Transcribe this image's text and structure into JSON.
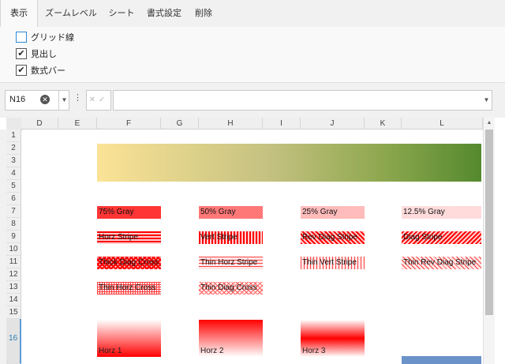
{
  "ribbon": {
    "tabs": [
      {
        "label": "表示",
        "active": true
      },
      {
        "label": "ズームレベル",
        "active": false
      },
      {
        "label": "シート",
        "active": false
      },
      {
        "label": "書式設定",
        "active": false
      },
      {
        "label": "削除",
        "active": false
      }
    ],
    "options": [
      {
        "label": "グリッド線",
        "checked": false
      },
      {
        "label": "見出し",
        "checked": true
      },
      {
        "label": "数式バー",
        "checked": true
      }
    ]
  },
  "formula_bar": {
    "name_box": "N16",
    "formula": ""
  },
  "sheet": {
    "columns": [
      "D",
      "E",
      "F",
      "G",
      "H",
      "I",
      "J",
      "K",
      "L"
    ],
    "rows": [
      "1",
      "2",
      "3",
      "4",
      "5",
      "6",
      "7",
      "8",
      "9",
      "10",
      "11",
      "12",
      "13",
      "14",
      "15",
      "16"
    ],
    "selected_row": "16",
    "gradient_colors": [
      "#fbe396",
      "#55892f"
    ],
    "pattern_cells": [
      {
        "label": "75% Gray",
        "style": "gray75"
      },
      {
        "label": "50% Gray",
        "style": "gray50"
      },
      {
        "label": "25% Gray",
        "style": "gray25"
      },
      {
        "label": "12.5% Gray",
        "style": "gray125"
      },
      {
        "label": "Horz Stripe",
        "style": "horz"
      },
      {
        "label": "Vert Stripe",
        "style": "vert"
      },
      {
        "label": "Rev Diag Stripe",
        "style": "revdiag"
      },
      {
        "label": "Diag Stripe",
        "style": "diag"
      },
      {
        "label": "Thick Diag Cross",
        "style": "thickcross"
      },
      {
        "label": "Thin Horz Stripe",
        "style": "thinhorz"
      },
      {
        "label": "Thin Vert Stripe",
        "style": "thinvert"
      },
      {
        "label": "Thin Rev Diag Stripe",
        "style": "thinrevdiag"
      },
      {
        "label": "Thin Horz Cross",
        "style": "thinhorzcross"
      },
      {
        "label": "Thin Diag Cross",
        "style": "thindiagcross"
      }
    ],
    "gradient_cells": [
      {
        "label": "Horz 1"
      },
      {
        "label": "Horz 2"
      },
      {
        "label": "Horz 3"
      }
    ],
    "pattern_color": "#ff0000"
  }
}
